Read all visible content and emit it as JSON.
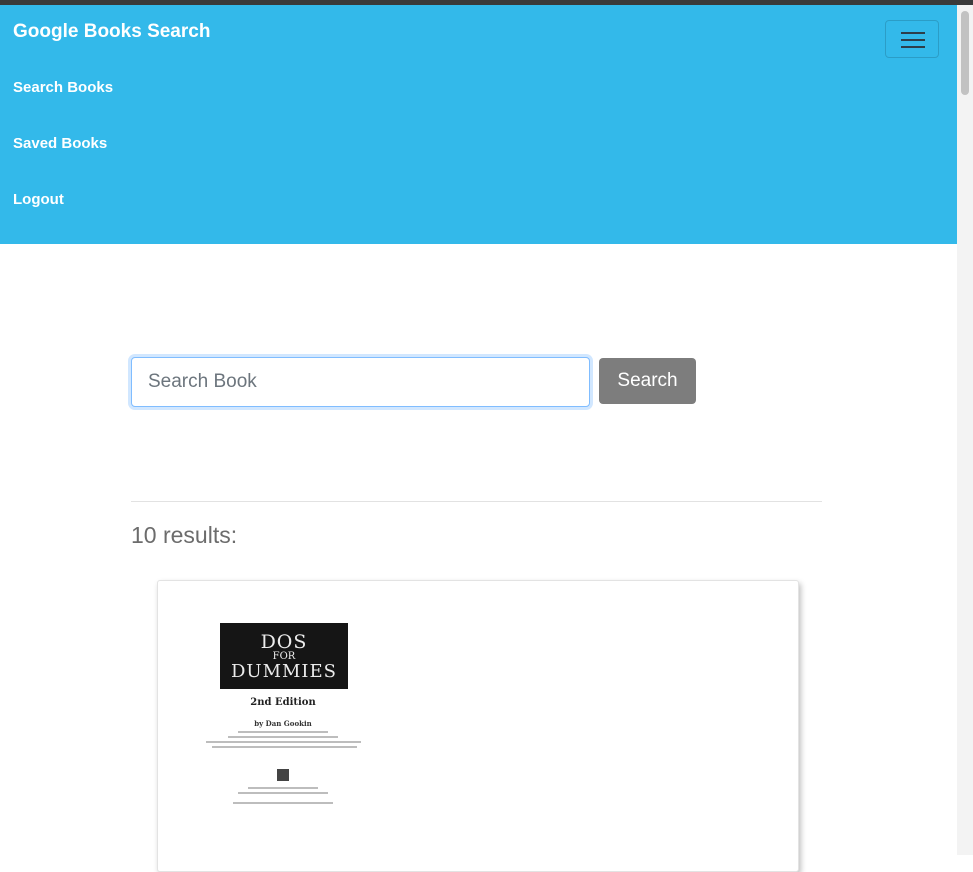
{
  "navbar": {
    "brand": "Google Books Search",
    "links": [
      "Search Books",
      "Saved Books",
      "Logout"
    ],
    "toggler_icon": "hamburger-menu-icon",
    "background_color": "#33b9ea"
  },
  "search": {
    "placeholder": "Search Book",
    "value": "",
    "button_label": "Search"
  },
  "results": {
    "heading": "10 results:"
  },
  "book_card": {
    "cover_title_line1": "DOS",
    "cover_title_line2": "FOR",
    "cover_title_line3": "DUMMIES",
    "cover_edition": "2nd Edition",
    "cover_author": "by Dan Gookin"
  }
}
